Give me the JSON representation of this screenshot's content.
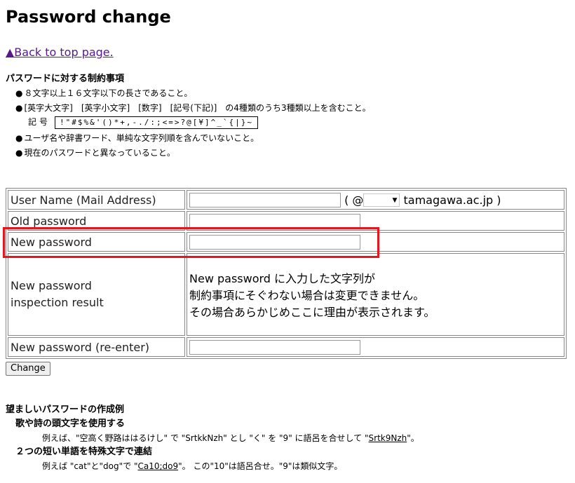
{
  "page": {
    "title": "Password change",
    "back_link": "▲Back to top page."
  },
  "rules": {
    "heading": "パスワードに対する制約事項",
    "bullet": "●",
    "items": [
      "８文字以上１６文字以下の長さであること。",
      "[英字大文字]　[英字小文字]　[数字]　[記号(下記)]　の4種類のうち3種類以上を含むこと。",
      "ユーザ名や辞書ワード、単純な文字列順を含んでいないこと。",
      "現在のパスワードと異なっていること。"
    ],
    "symbols_label": "記号",
    "symbols": "!\"#$%&'()*+,-./:;<=>?@[¥]^_`{|}~"
  },
  "form": {
    "username_label": "User Name (Mail Address)",
    "username_value": "",
    "domain_open": "( @",
    "domain_select": "",
    "domain_suffix": "tamagawa.ac.jp )",
    "old_password_label": "Old password",
    "new_password_label": "New password",
    "inspection_label_1": "New password",
    "inspection_label_2": "inspection result",
    "inspection_lines": [
      "New password に入力した文字列が",
      "制約事項にそぐわない場合は変更できません。",
      "その場合あらかじめここに理由が表示されます。"
    ],
    "reenter_label": "New password (re-enter)",
    "submit_label": "Change"
  },
  "examples": {
    "heading": "望ましいパスワードの作成例",
    "items": [
      {
        "title": "歌や詩の頭文字を使用する",
        "text_before": "例えば、\"空高く野路ははるけし\" で \"SrtkkNzh\" とし \"く\" を \"9\" に語呂を合せして \"",
        "text_link": "Srtk9Nzh",
        "text_after": "\"。"
      },
      {
        "title": "２つの短い単語を特殊文字で連結",
        "text_before": "例えば \"cat\"と\"dog\"で \"",
        "text_link": "Ca10;do9",
        "text_after": "\"。 この\"10\"は語呂合せ。\"9\"は類似文字。"
      }
    ]
  },
  "colors": {
    "highlight": "#e8161c",
    "link": "#551a8b"
  }
}
